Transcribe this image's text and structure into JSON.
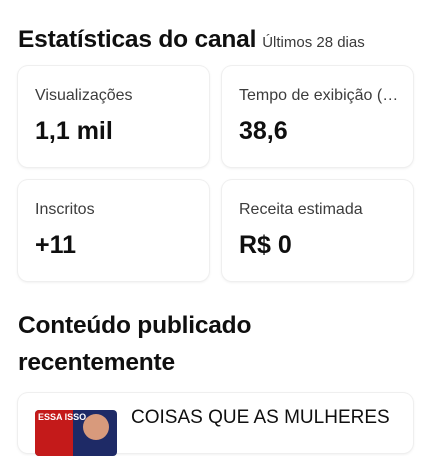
{
  "header": {
    "title": "Estatísticas do canal",
    "period": "Últimos 28 dias"
  },
  "stats": [
    {
      "label": "Visualizações",
      "value": "1,1 mil"
    },
    {
      "label": "Tempo de exibição (horas)",
      "value": "38,6"
    },
    {
      "label": "Inscritos",
      "value": "+11"
    },
    {
      "label": "Receita estimada",
      "value": "R$ 0"
    }
  ],
  "recent": {
    "title": "Conteúdo publicado recentemente",
    "items": [
      {
        "title": "COISAS QUE AS MULHERES",
        "thumb_text": "ESSA ISSO"
      }
    ]
  }
}
